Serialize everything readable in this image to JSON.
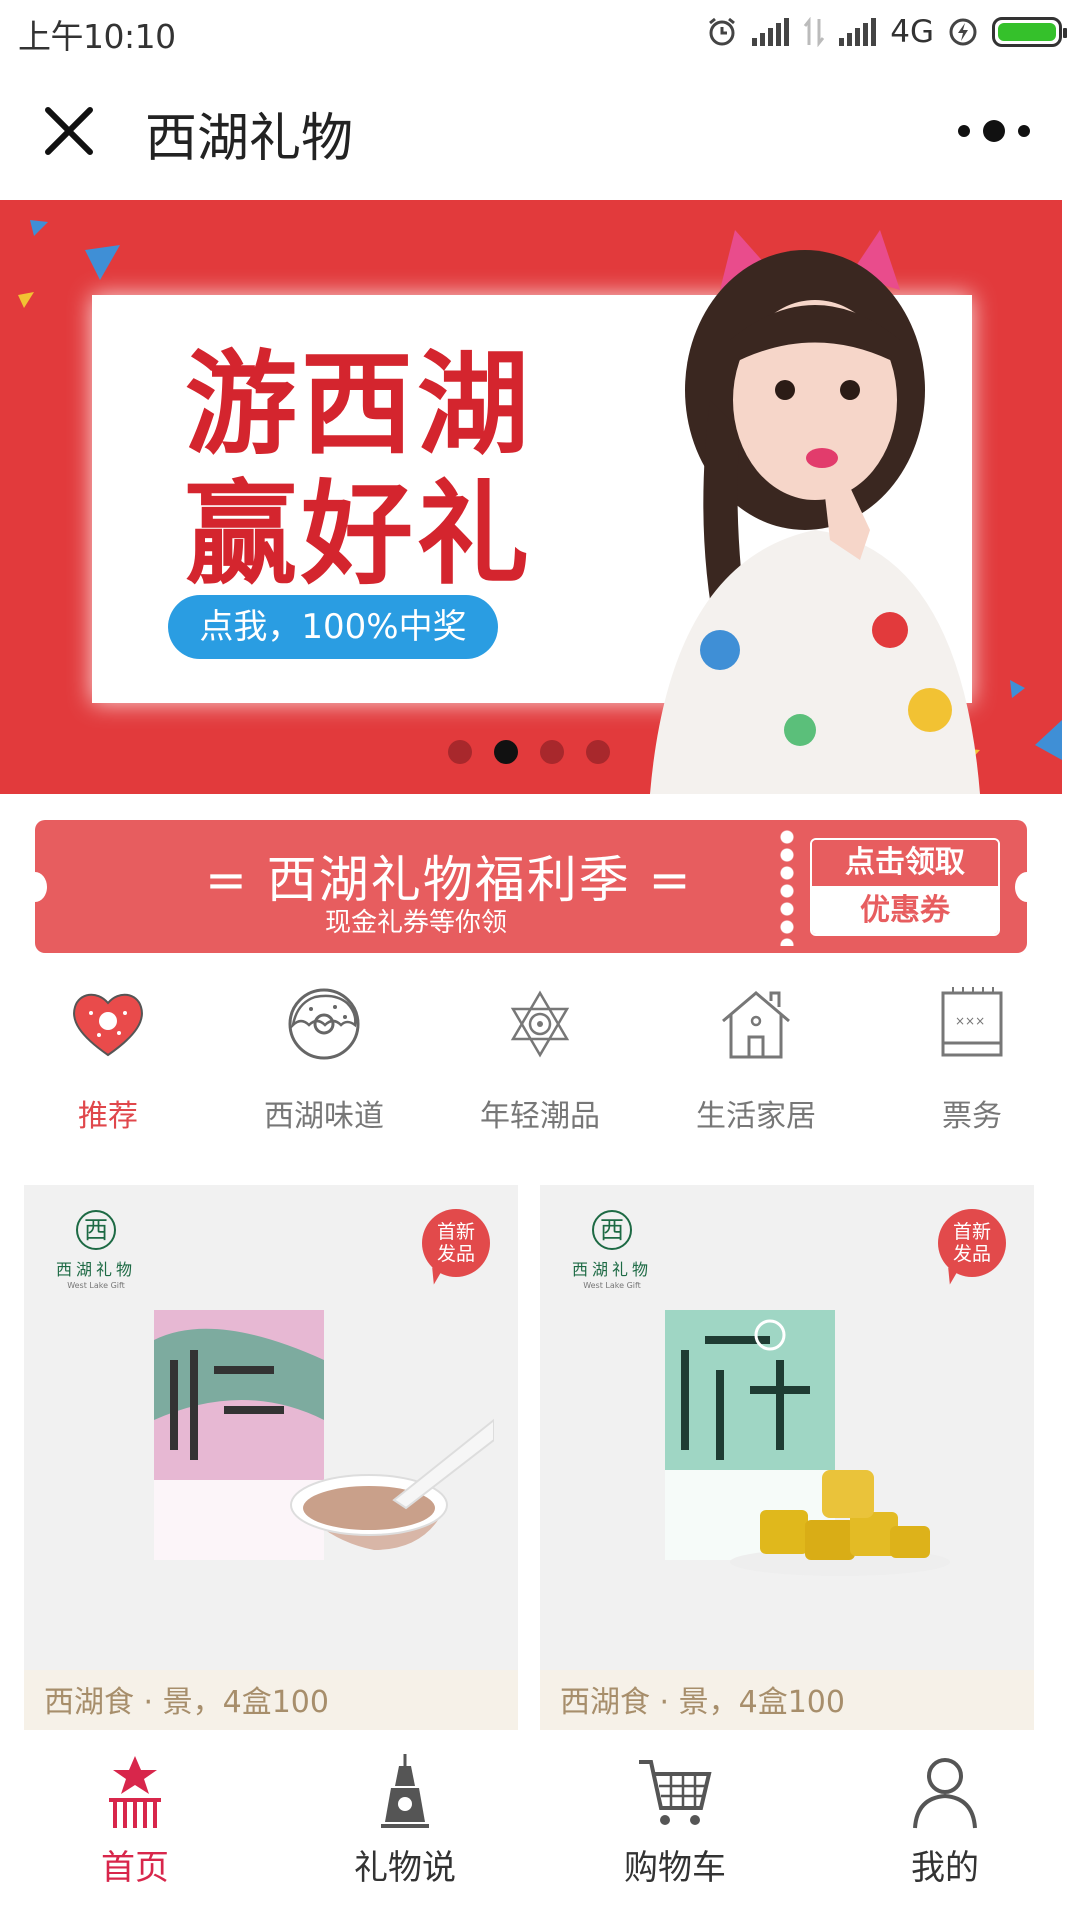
{
  "status_bar": {
    "time": "上午10:10",
    "network": "4G",
    "battery_level": 1.0
  },
  "title_bar": {
    "close_icon": "close-icon",
    "title": "西湖礼物",
    "more_icon": "more-dots-icon"
  },
  "banner": {
    "headline_line1": "游西湖",
    "headline_line2": "赢好礼",
    "cta": "点我，100%中奖",
    "slide_count": 4,
    "active_slide": 2
  },
  "coupon": {
    "title": "= 西湖礼物福利季 =",
    "subtitle": "现金礼券等你领",
    "button_top": "点击领取",
    "button_bottom": "优惠券"
  },
  "categories": [
    {
      "label": "推荐",
      "icon": "heart-donut-icon",
      "active": true
    },
    {
      "label": "西湖味道",
      "icon": "donut-icon",
      "active": false
    },
    {
      "label": "年轻潮品",
      "icon": "star-icon",
      "active": false
    },
    {
      "label": "生活家居",
      "icon": "house-icon",
      "active": false
    },
    {
      "label": "票务",
      "icon": "ticket-icon",
      "active": false
    }
  ],
  "products": [
    {
      "brand_char": "西",
      "brand_name": "西湖礼物",
      "brand_en": "West Lake Gift",
      "badge": "首新发品",
      "badge_line1": "首新",
      "badge_line2": "发品",
      "caption": "西湖食 · 景，4盒100"
    },
    {
      "brand_char": "西",
      "brand_name": "西湖礼物",
      "brand_en": "West Lake Gift",
      "badge": "首新发品",
      "badge_line1": "首新",
      "badge_line2": "发品",
      "caption": "西湖食 · 景，4盒100"
    }
  ],
  "bottom_nav": [
    {
      "label": "首页",
      "icon": "pagoda-icon",
      "active": true
    },
    {
      "label": "礼物说",
      "icon": "tower-icon",
      "active": false
    },
    {
      "label": "购物车",
      "icon": "cart-icon",
      "active": false
    },
    {
      "label": "我的",
      "icon": "user-icon",
      "active": false
    }
  ],
  "colors": {
    "brand_red": "#e23a3c",
    "accent_pink": "#d8264b",
    "coupon": "#e75d5f",
    "caption_text": "#a78e6b"
  }
}
